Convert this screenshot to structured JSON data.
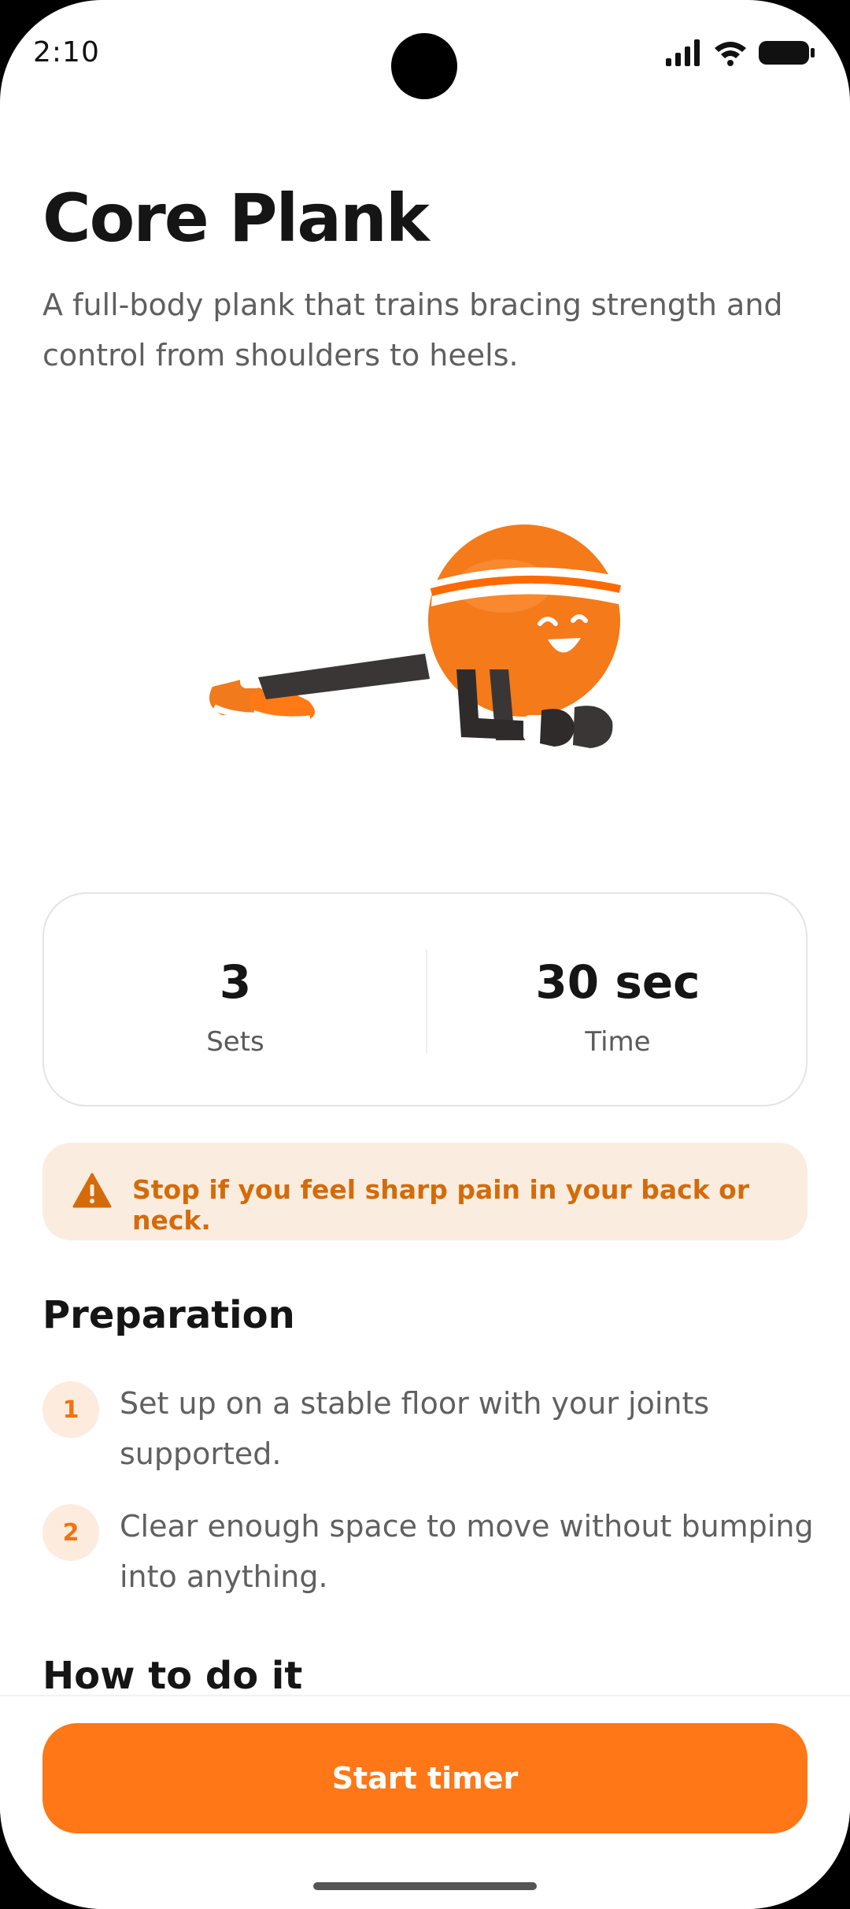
{
  "status_bar": {
    "time": "2:10"
  },
  "exercise": {
    "title": "Core Plank",
    "description": "A full-body plank that trains bracing strength and control from shoulders to heels."
  },
  "stats": [
    {
      "value": "3",
      "label": "Sets"
    },
    {
      "value": "30 sec",
      "label": "Time"
    }
  ],
  "warning": {
    "text": "Stop if you feel sharp pain in your back or neck."
  },
  "preparation": {
    "title": "Preparation",
    "steps": [
      {
        "number": "1",
        "text": "Set up on a stable floor with your joints supported."
      },
      {
        "number": "2",
        "text": "Clear enough space to move without bumping into anything."
      }
    ]
  },
  "how_to": {
    "title": "How to do it"
  },
  "actions": {
    "start_label": "Start timer"
  },
  "colors": {
    "accent": "#ff7716",
    "warning_bg": "#faede0",
    "warning_text": "#d46b0a"
  }
}
